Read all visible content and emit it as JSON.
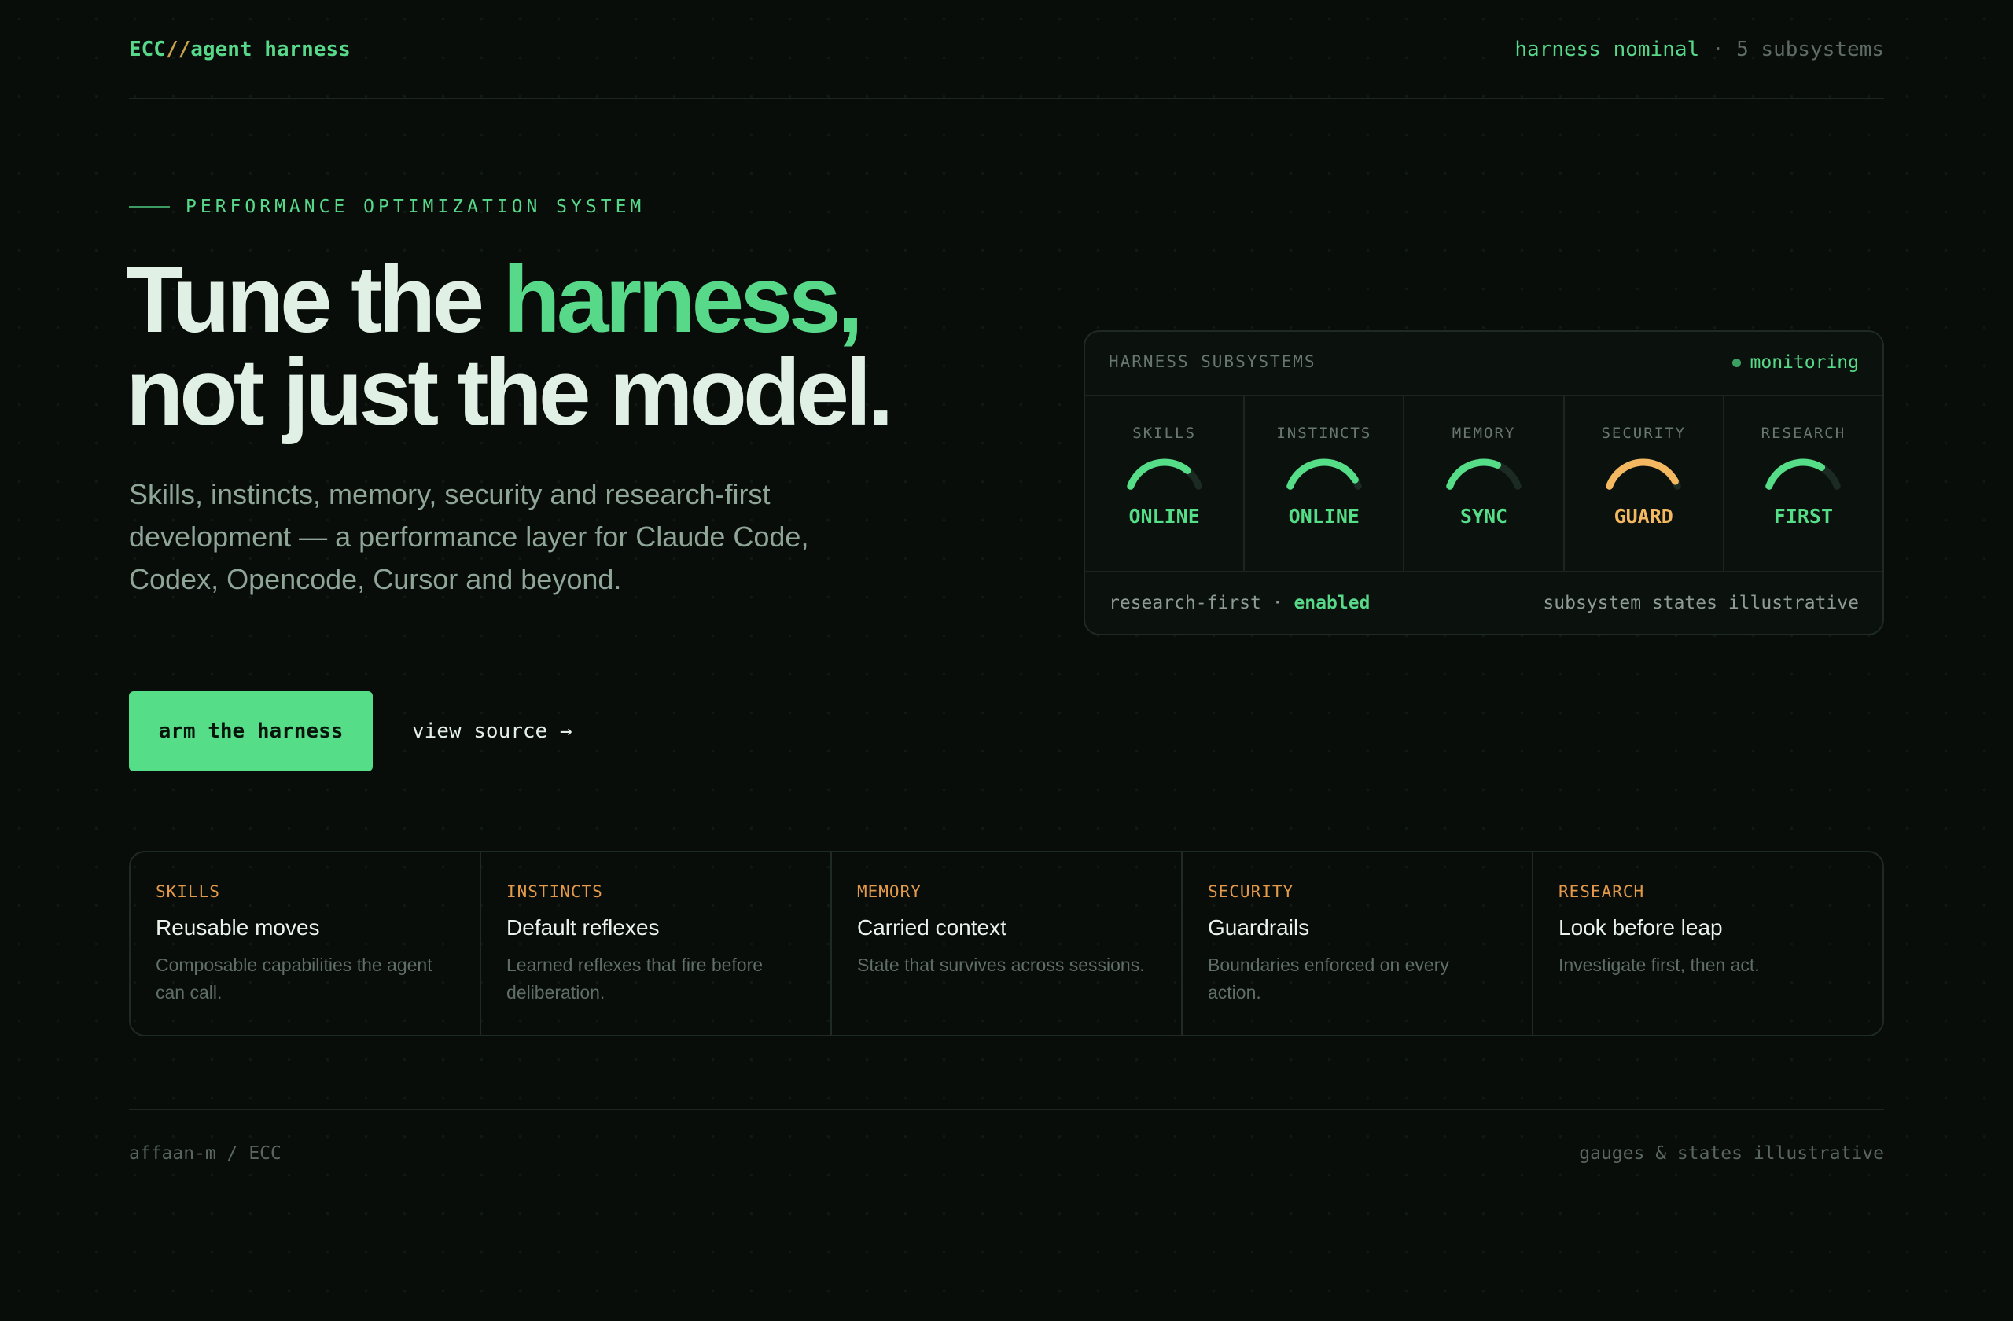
{
  "header": {
    "logo_prefix": "ECC",
    "logo_sep": "//",
    "logo_name": "agent harness",
    "status_ok": "harness nominal",
    "status_dot": "·",
    "status_count": "5 subsystems"
  },
  "hero": {
    "eyebrow": "PERFORMANCE OPTIMIZATION SYSTEM",
    "headline_a": "Tune the ",
    "headline_hl": "harness,",
    "headline_b": "not just the model.",
    "subcopy": "Skills, instincts, memory, security and research-first development — a performance layer for Claude Code, Codex, Opencode, Cursor and beyond.",
    "cta_label": "arm the harness",
    "source_label": "view source →"
  },
  "panel": {
    "title": "HARNESS SUBSYSTEMS",
    "monitor_label": "monitoring",
    "gauges": [
      {
        "label": "SKILLS",
        "state": "ONLINE",
        "level": 0.78,
        "color": "#55dd87"
      },
      {
        "label": "INSTINCTS",
        "state": "ONLINE",
        "level": 0.92,
        "color": "#55dd87"
      },
      {
        "label": "MEMORY",
        "state": "SYNC",
        "level": 0.66,
        "color": "#55dd87"
      },
      {
        "label": "SECURITY",
        "state": "GUARD",
        "level": 0.94,
        "color": "#f4b861"
      },
      {
        "label": "RESEARCH",
        "state": "FIRST",
        "level": 0.72,
        "color": "#55dd87"
      }
    ],
    "footer_key": "research-first",
    "footer_dot": "·",
    "footer_value": "enabled",
    "footer_note": "subsystem states illustrative"
  },
  "features": [
    {
      "kicker": "SKILLS",
      "title": "Reusable moves",
      "desc": "Composable capabilities the agent can call."
    },
    {
      "kicker": "INSTINCTS",
      "title": "Default reflexes",
      "desc": "Learned reflexes that fire before deliberation."
    },
    {
      "kicker": "MEMORY",
      "title": "Carried context",
      "desc": "State that survives across sessions."
    },
    {
      "kicker": "SECURITY",
      "title": "Guardrails",
      "desc": "Boundaries enforced on every action."
    },
    {
      "kicker": "RESEARCH",
      "title": "Look before leap",
      "desc": "Investigate first, then act."
    }
  ],
  "footer": {
    "left": "affaan-m / ECC",
    "right": "gauges & states illustrative"
  }
}
